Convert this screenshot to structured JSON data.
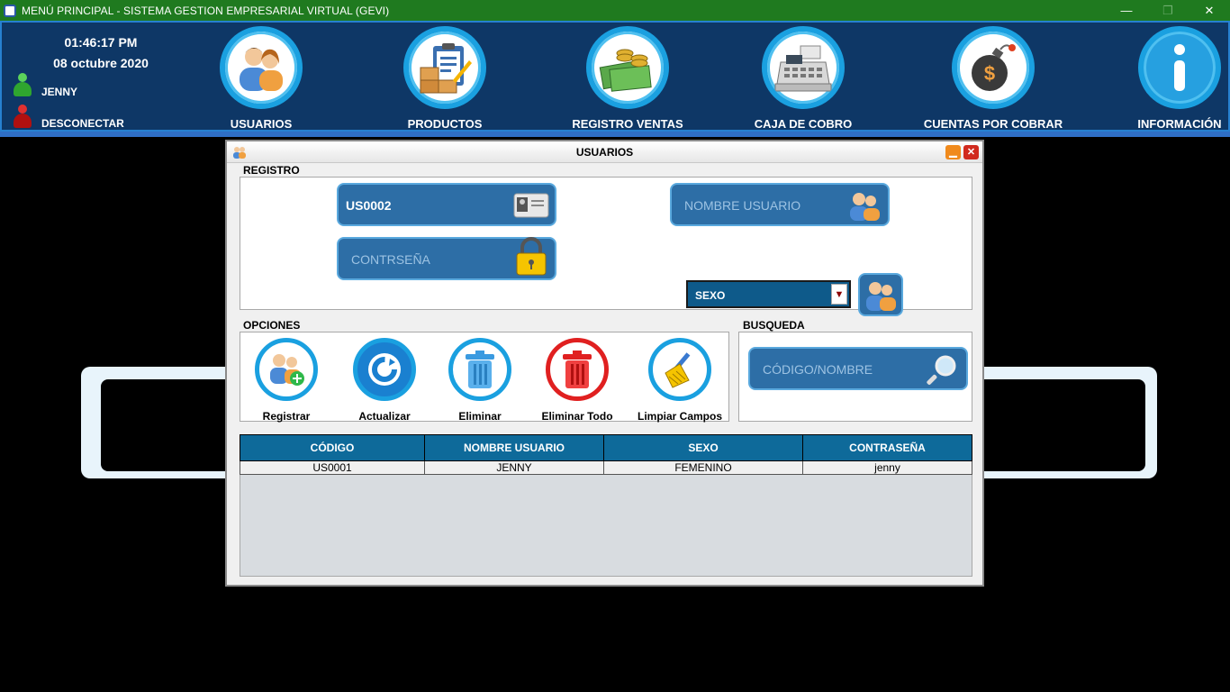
{
  "window": {
    "title": "MENÚ PRINCIPAL - SISTEMA GESTION EMPRESARIAL VIRTUAL (GEVI)",
    "minimize": "—",
    "maximize": "❐",
    "close": "✕"
  },
  "header": {
    "time": "01:46:17 PM",
    "date": "08 octubre 2020",
    "user": "JENNY",
    "disconnect": "DESCONECTAR",
    "nav": [
      {
        "label": "USUARIOS",
        "icon": "users-icon"
      },
      {
        "label": "PRODUCTOS",
        "icon": "products-clipboard-icon"
      },
      {
        "label": "REGISTRO VENTAS",
        "icon": "money-coins-icon"
      },
      {
        "label": "CAJA DE COBRO",
        "icon": "cash-register-icon"
      },
      {
        "label": "CUENTAS POR COBRAR",
        "icon": "bomb-dollar-icon"
      },
      {
        "label": "INFORMACIÓN",
        "icon": "info-icon"
      }
    ]
  },
  "dialog": {
    "title": "USUARIOS",
    "registro_label": "REGISTRO",
    "codigo_value": "US0002",
    "nombre_placeholder": "NOMBRE USUARIO",
    "password_placeholder": "CONTRSEÑA",
    "sexo_value": "SEXO",
    "opciones_label": "OPCIONES",
    "busqueda_label": "BUSQUEDA",
    "search_placeholder": "CÓDIGO/NOMBRE",
    "options": [
      "Registrar",
      "Actualizar",
      "Eliminar",
      "Eliminar Todo",
      "Limpiar Campos"
    ],
    "table": {
      "headers": [
        "CÓDIGO",
        "NOMBRE USUARIO",
        "SEXO",
        "CONTRASEÑA"
      ],
      "rows": [
        [
          "US0001",
          "JENNY",
          "FEMENINO",
          "jenny"
        ]
      ]
    }
  },
  "colors": {
    "title_green": "#1f7a1f",
    "header_blue": "#0e3766",
    "accent": "#1aa0e0",
    "field": "#2d6ea6",
    "delete_red": "#e02020"
  }
}
